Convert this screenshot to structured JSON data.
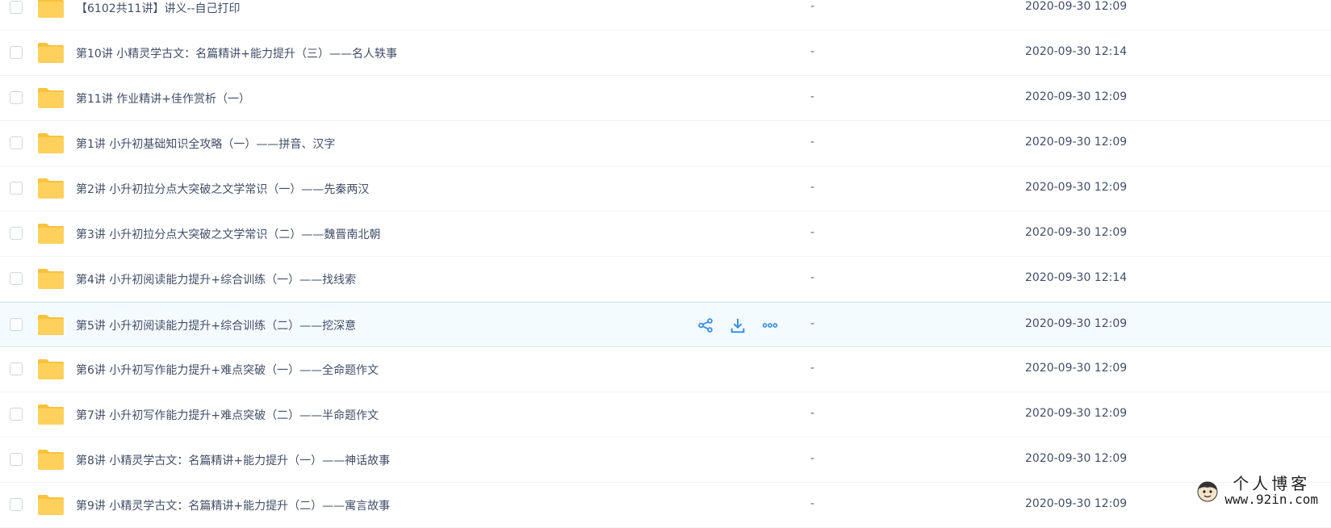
{
  "rows": [
    {
      "name": "【6102共11讲】讲义--自己打印",
      "size": "-",
      "date": "2020-09-30 12:09"
    },
    {
      "name": "第10讲 小精灵学古文：名篇精讲+能力提升（三）——名人轶事",
      "size": "-",
      "date": "2020-09-30 12:14"
    },
    {
      "name": "第11讲 作业精讲+佳作赏析（一）",
      "size": "-",
      "date": "2020-09-30 12:09"
    },
    {
      "name": "第1讲 小升初基础知识全攻略（一）——拼音、汉字",
      "size": "-",
      "date": "2020-09-30 12:09"
    },
    {
      "name": "第2讲 小升初拉分点大突破之文学常识（一）——先秦两汉",
      "size": "-",
      "date": "2020-09-30 12:09"
    },
    {
      "name": "第3讲 小升初拉分点大突破之文学常识（二）——魏晋南北朝",
      "size": "-",
      "date": "2020-09-30 12:09"
    },
    {
      "name": "第4讲 小升初阅读能力提升+综合训练（一）——找线索",
      "size": "-",
      "date": "2020-09-30 12:14"
    },
    {
      "name": "第5讲 小升初阅读能力提升+综合训练（二）——挖深意",
      "size": "-",
      "date": "2020-09-30 12:09"
    },
    {
      "name": "第6讲 小升初写作能力提升+难点突破（一）——全命题作文",
      "size": "-",
      "date": "2020-09-30 12:09"
    },
    {
      "name": "第7讲 小升初写作能力提升+难点突破（二）——半命题作文",
      "size": "-",
      "date": "2020-09-30 12:09"
    },
    {
      "name": "第8讲 小精灵学古文：名篇精讲+能力提升（一）——神话故事",
      "size": "-",
      "date": "2020-09-30 12:09"
    },
    {
      "name": "第9讲 小精灵学古文：名篇精讲+能力提升（二）——寓言故事",
      "size": "-",
      "date": "2020-09-30 12:09"
    }
  ],
  "hover_row_index": 7,
  "row_actions": {
    "share_icon": "share-icon",
    "download_icon": "download-icon",
    "more_icon": "more-icon"
  },
  "watermark": {
    "title": "个人博客",
    "url": "www.92in.com"
  },
  "colors": {
    "folder": "#ffd15c",
    "folder_tab": "#f9c23c",
    "action_blue": "#3a8ee6",
    "hover_bg": "#f4fbff"
  }
}
